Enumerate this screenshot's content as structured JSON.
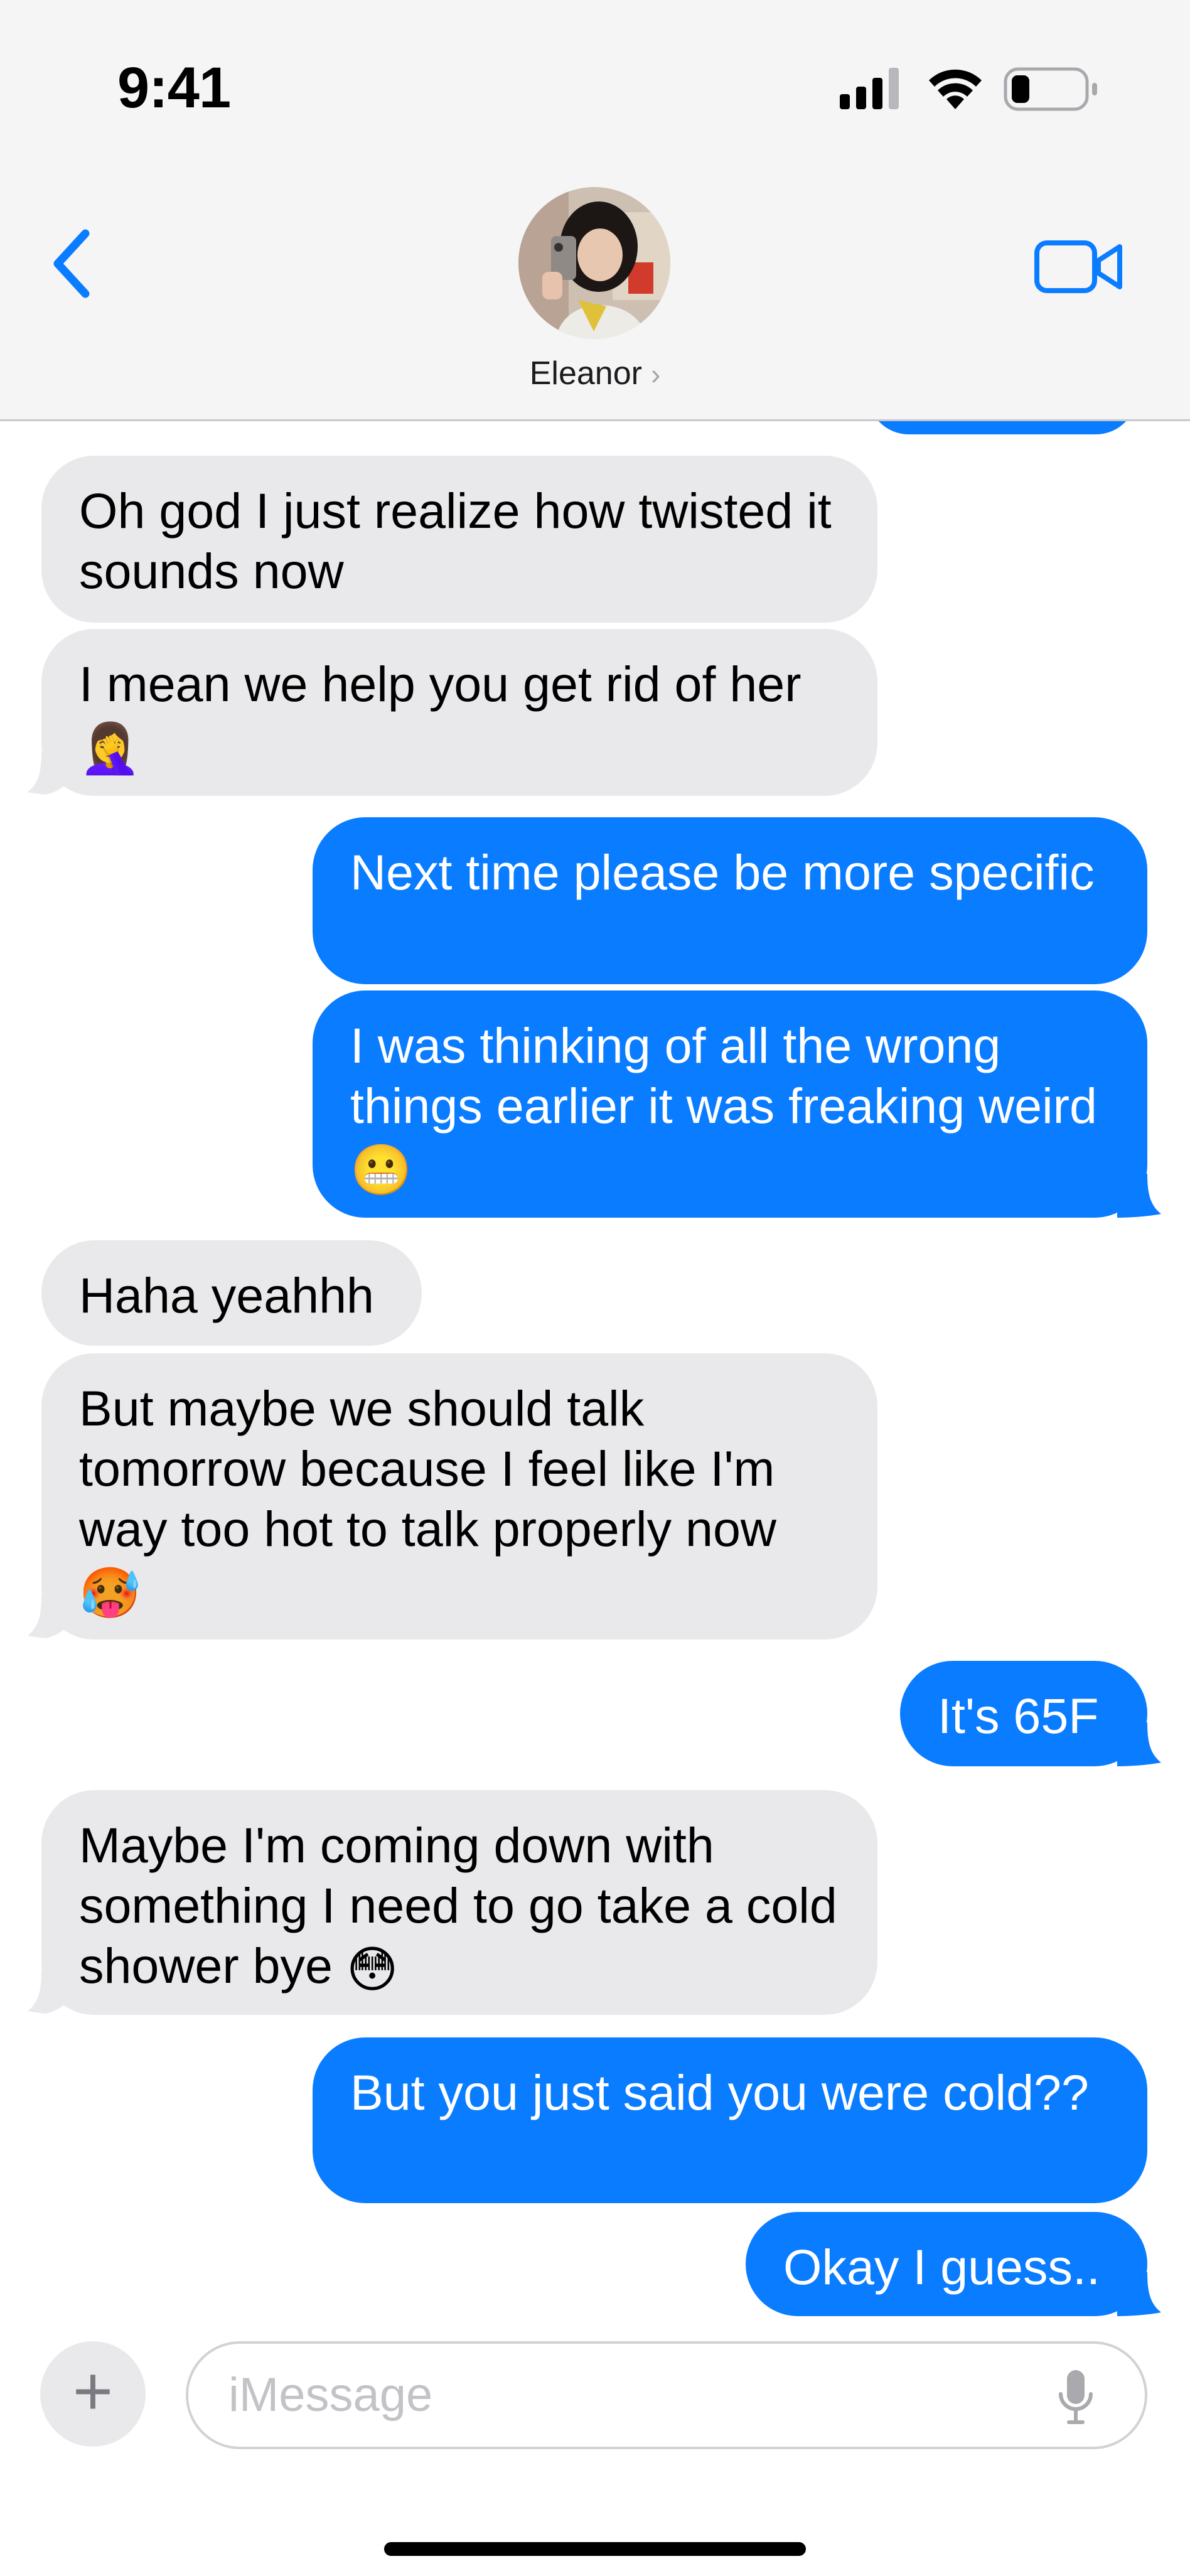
{
  "status_bar": {
    "time": "9:41"
  },
  "header": {
    "contact_name": "Eleanor",
    "chevron": "›"
  },
  "messages": [
    {
      "from": "them",
      "text": "Oh god I just realize how twisted it sounds now"
    },
    {
      "from": "them",
      "text": "I mean we help you get rid of her",
      "emoji": "🤦‍♀️"
    },
    {
      "from": "me",
      "text": "Next time please be more specific"
    },
    {
      "from": "me",
      "text": "I was thinking of all the wrong things earlier it was freaking weird",
      "emoji": "😬"
    },
    {
      "from": "them",
      "text": "Haha yeahhh"
    },
    {
      "from": "them",
      "text": "But maybe we should talk tomorrow because I feel like I'm way too hot to talk properly now",
      "emoji": "🥵"
    },
    {
      "from": "me",
      "text": "It's 65F"
    },
    {
      "from": "them",
      "text": "Maybe I'm coming down with something I need to go take a cold shower bye",
      "emoji": "😳"
    },
    {
      "from": "me",
      "text": "But you just said you were cold??"
    },
    {
      "from": "me",
      "text": "Okay I guess.."
    }
  ],
  "input": {
    "placeholder": "iMessage",
    "plus": "+"
  },
  "icons": {
    "back": "chevron-left-icon",
    "video": "video-camera-icon",
    "signal": "cellular-signal-icon",
    "wifi": "wifi-icon",
    "battery": "battery-icon",
    "mic": "microphone-icon"
  },
  "colors": {
    "outgoing_bubble": "#0a7cff",
    "incoming_bubble": "#e9e9eb",
    "accent": "#0a7cff"
  }
}
